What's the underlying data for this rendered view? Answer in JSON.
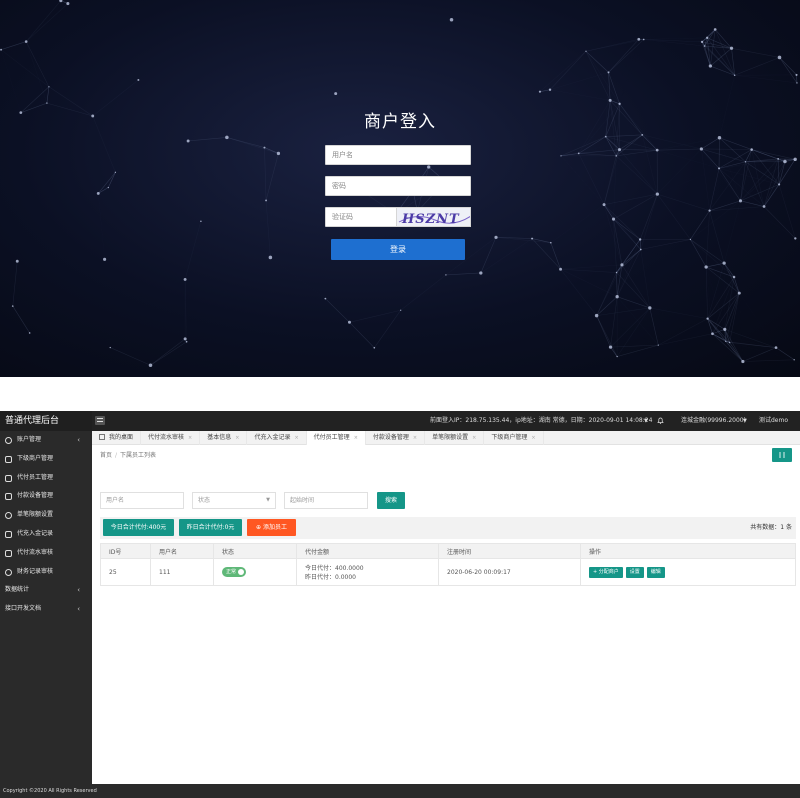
{
  "login": {
    "title": "商户登入",
    "username_placeholder": "用户名",
    "password_placeholder": "密码",
    "captcha_placeholder": "验证码",
    "captcha_text": "HSZNT",
    "submit_label": "登录"
  },
  "admin": {
    "brand": "普通代理后台",
    "header": {
      "login_info": "前面登入IP：218.75.135.44，ip地址：湖南 常德，日期：2020-09-01 14:08:24",
      "user": "连城金融(99996.2000)",
      "account": "测试demo"
    },
    "sidebar": {
      "items": [
        {
          "label": "账户管理",
          "icon": "user-icon",
          "chevron": "‹"
        },
        {
          "label": "下级商户管理",
          "icon": "person-icon",
          "chevron": ""
        },
        {
          "label": "代付员工管理",
          "icon": "users-icon",
          "chevron": ""
        },
        {
          "label": "付款设备管理",
          "icon": "phone-icon",
          "chevron": ""
        },
        {
          "label": "单笔限额设置",
          "icon": "clock-icon",
          "chevron": ""
        },
        {
          "label": "代充入金记录",
          "icon": "calendar-icon",
          "chevron": ""
        },
        {
          "label": "代付流水审核",
          "icon": "shield-icon",
          "chevron": ""
        },
        {
          "label": "财务记录审核",
          "icon": "coin-icon",
          "chevron": ""
        },
        {
          "label": "数据统计",
          "icon": "",
          "chevron": "‹"
        },
        {
          "label": "接口开发文档",
          "icon": "",
          "chevron": "‹"
        }
      ]
    },
    "tabs": [
      {
        "label": "我的桌面",
        "home": true
      },
      {
        "label": "代付流水审核"
      },
      {
        "label": "基本信息"
      },
      {
        "label": "代充入金记录"
      },
      {
        "label": "代付员工管理",
        "active": true
      },
      {
        "label": "付款设备管理"
      },
      {
        "label": "单笔限额设置"
      },
      {
        "label": "下级商户管理"
      }
    ],
    "breadcrumb": {
      "home": "首页",
      "current": "下属员工列表"
    },
    "filters": {
      "username_placeholder": "用户名",
      "status_placeholder": "状态",
      "time_placeholder": "起始时间",
      "search_label": "搜索"
    },
    "toolbar": {
      "today_total": "今日合计代付:400元",
      "yesterday_total": "昨日合计代付:0元",
      "add_employee": "添加员工",
      "total_count": "共有数据：1 条"
    },
    "table": {
      "columns": [
        "ID号",
        "用户名",
        "状态",
        "代付金额",
        "注册时间",
        "操作"
      ],
      "rows": [
        {
          "id": "25",
          "username": "111",
          "status": "正常",
          "amount_today": "今日代付：400.0000",
          "amount_yesterday": "昨日代付：0.0000",
          "register_time": "2020-06-20 00:09:17",
          "actions": [
            "+ 分配商户",
            "设置",
            "编辑"
          ]
        }
      ]
    },
    "footer": "Copyright ©2020 All Rights Reserved"
  },
  "colors": {
    "teal": "#159688",
    "orange": "#ff5722",
    "login_blue": "#1e6fd0",
    "switch_green": "#5fb878"
  }
}
